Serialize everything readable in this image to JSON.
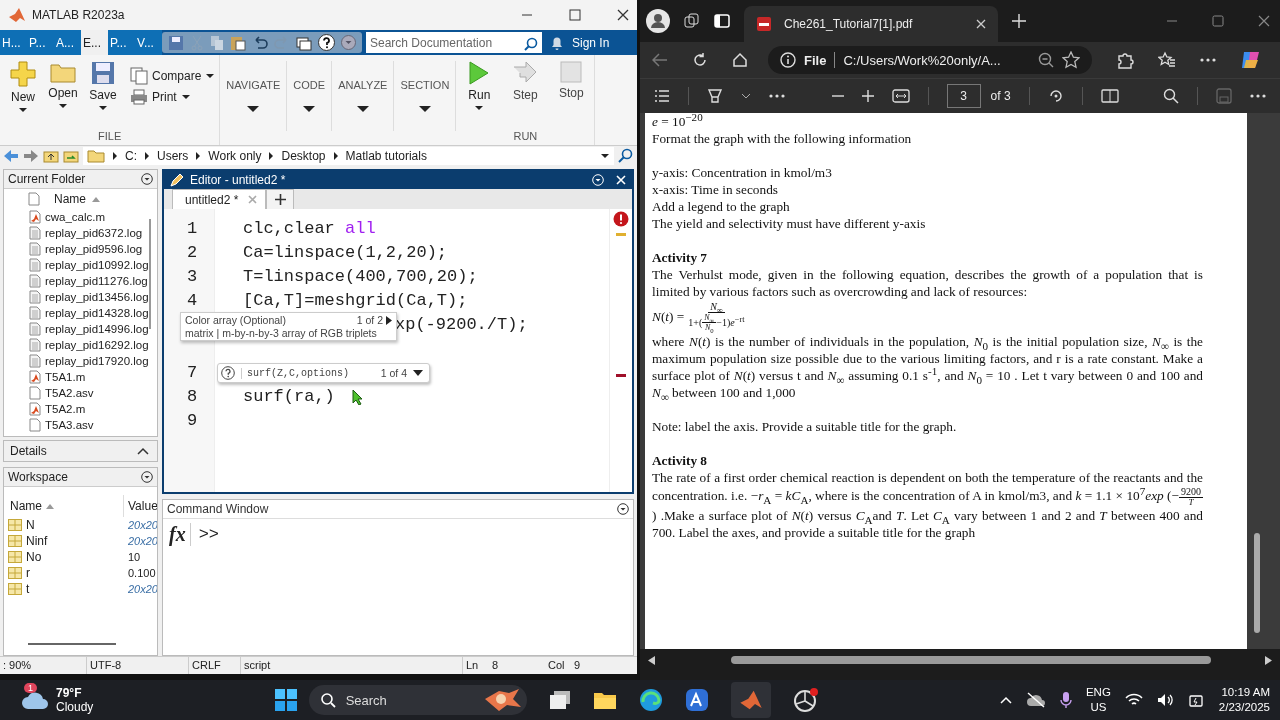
{
  "matlab": {
    "title": "MATLAB R2023a",
    "tabs": [
      {
        "label": "H...",
        "selected": false
      },
      {
        "label": "P...",
        "selected": false
      },
      {
        "label": "A...",
        "selected": false
      },
      {
        "label": "E...",
        "selected": true
      },
      {
        "label": "P...",
        "selected": false
      },
      {
        "label": "V...",
        "selected": false
      }
    ],
    "search": {
      "placeholder": "Search Documentation"
    },
    "sign_in": "Sign In",
    "file_buttons": [
      {
        "kind": "new",
        "label": "New"
      },
      {
        "kind": "open",
        "label": "Open"
      },
      {
        "kind": "save",
        "label": "Save"
      }
    ],
    "compare": "Compare",
    "print": "Print",
    "file_group": "FILE",
    "menus": [
      "NAVIGATE",
      "CODE",
      "ANALYZE",
      "SECTION"
    ],
    "run_buttons": [
      {
        "kind": "run",
        "label": "Run",
        "disabled": false
      },
      {
        "kind": "step",
        "label": "Step",
        "disabled": true
      },
      {
        "kind": "stop",
        "label": "Stop",
        "disabled": true
      }
    ],
    "run_group": "RUN",
    "path": [
      "C:",
      "Users",
      "Work only",
      "Desktop",
      "Matlab tutorials"
    ],
    "current_folder": {
      "title": "Current Folder",
      "column": "Name",
      "files": [
        {
          "name": "cwa_calc.m",
          "kind": "script"
        },
        {
          "name": "replay_pid6372.log",
          "kind": "text"
        },
        {
          "name": "replay_pid9596.log",
          "kind": "text"
        },
        {
          "name": "replay_pid10992.log",
          "kind": "text"
        },
        {
          "name": "replay_pid11276.log",
          "kind": "text"
        },
        {
          "name": "replay_pid13456.log",
          "kind": "text"
        },
        {
          "name": "replay_pid14328.log",
          "kind": "text"
        },
        {
          "name": "replay_pid14996.log",
          "kind": "text"
        },
        {
          "name": "replay_pid16292.log",
          "kind": "text"
        },
        {
          "name": "replay_pid17920.log",
          "kind": "text"
        },
        {
          "name": "T5A1.m",
          "kind": "script"
        },
        {
          "name": "T5A2.asv",
          "kind": "blank"
        },
        {
          "name": "T5A2.m",
          "kind": "script"
        },
        {
          "name": "T5A3.asv",
          "kind": "blank"
        }
      ]
    },
    "details": "Details",
    "workspace": {
      "title": "Workspace",
      "columns": [
        "Name",
        "Value"
      ],
      "vars": [
        {
          "name": "N",
          "value": "20x20",
          "kind": "matrix"
        },
        {
          "name": "Ninf",
          "value": "20x20",
          "kind": "matrix"
        },
        {
          "name": "No",
          "value": "10",
          "kind": "scalar"
        },
        {
          "name": "r",
          "value": "0.100",
          "kind": "scalar"
        },
        {
          "name": "t",
          "value": "20x20",
          "kind": "matrix"
        }
      ]
    },
    "editor": {
      "title": "Editor - untitled2 *",
      "tab": "untitled2 *",
      "lines": [
        {
          "num": "1",
          "kind": "code",
          "parts": [
            {
              "text": "clc,clear ",
              "kind": "plain"
            },
            {
              "text": "all",
              "kind": "keyword"
            }
          ]
        },
        {
          "num": "2",
          "kind": "code",
          "parts": [
            {
              "text": "Ca=linspace(1,2,20);",
              "kind": "plain"
            }
          ]
        },
        {
          "num": "3",
          "kind": "code",
          "parts": [
            {
              "text": "T=linspace(400,700,20);",
              "kind": "plain"
            }
          ]
        },
        {
          "num": "4",
          "kind": "code",
          "parts": [
            {
              "text": "[Ca,T]=meshgrid(Ca,T);",
              "kind": "plain"
            }
          ]
        },
        {
          "kind": "covered",
          "parts": [
            {
              "text": "xp(-9200./T);",
              "kind": "plain"
            }
          ]
        },
        {
          "kind": "hidden"
        },
        {
          "num": "7",
          "kind": "hidden"
        },
        {
          "num": "8",
          "kind": "code",
          "parts": [
            {
              "text": "surf(ra,)",
              "kind": "plain"
            }
          ]
        },
        {
          "num": "9",
          "kind": "code"
        }
      ],
      "hint": {
        "title": "Color array (Optional)",
        "count": "1 of 2",
        "detail": "matrix | m-by-n-by-3 array of RGB triplets"
      },
      "signature": {
        "text": "surf(Z,C,options)",
        "count": "1 of 4"
      }
    },
    "command_window": {
      "title": "Command Window",
      "fx": "fx",
      "prompt": ">>"
    },
    "status_bar": {
      "zoom": ": 90%",
      "encoding": "UTF-8",
      "line_ending": "CRLF",
      "type": "script",
      "ln_label": "Ln",
      "ln": "8",
      "col_label": "Col",
      "col": "9"
    }
  },
  "browser": {
    "tab": "Che261_Tutorial7[1].pdf",
    "file_label": "File",
    "url": "C:/Users/Work%20only/A...",
    "page": "3",
    "page_total": "of 3",
    "pdf": [
      {
        "kind": "line",
        "text": "*e* = 10$^{−20}$"
      },
      {
        "kind": "line",
        "text": "Format the graph with the following information"
      },
      {
        "kind": "gap"
      },
      {
        "kind": "line",
        "text": "y-axis: Concentration in kmol/m3"
      },
      {
        "kind": "line",
        "text": "x-axis: Time in seconds"
      },
      {
        "kind": "line",
        "text": "Add a legend to the graph"
      },
      {
        "kind": "line",
        "text": "The yield and selectivity must have different y-axis"
      },
      {
        "kind": "gap"
      },
      {
        "kind": "heading",
        "text": "Activity 7"
      },
      {
        "kind": "para",
        "text": "The Verhulst mode, given in the following equation, describes the growth of a population that is limited by various factors such as overcrowding and lack of resources:"
      },
      {
        "kind": "formula",
        "lhs": "*N*(*t*) =",
        "num": "*N*$_{∞}$",
        "den_before": "1+(",
        "inner_num": "*N*$_{∞}$",
        "inner_den": "*N*$_{0}$",
        "den_after": "−1)*e*$^{−rt}$"
      },
      {
        "kind": "para",
        "text": "where *N*(*t*) is the number of individuals in the population, *N*$_{0}$ is the initial population size, *N*$_{∞}$ is the maximum population size possible due to the various limiting factors, and r is a rate constant. Make a surface plot of *N*(*t*) versus t and *N*$_{∞}$ assuming 0.1 s$^{-1}$, and *N*$_{0}$ = 10 . Let t vary between 0 and 100 and *N*$_{∞}$ between 100 and 1,000"
      },
      {
        "kind": "gap"
      },
      {
        "kind": "line",
        "text": "Note: label the axis. Provide a suitable title for the graph."
      },
      {
        "kind": "gap"
      },
      {
        "kind": "heading",
        "text": "Activity 8"
      },
      {
        "kind": "para_frac",
        "before": "The rate of a first order chemical reaction is dependent on both the temperature of the reactants and the concentration. i.e. −*r*$_{A}$ = *kC*$_{A}$, where is the concentration of A in kmol/m3, and *k* = 1.1 × 10$^{7}$*exp* (−",
        "num": "9200",
        "den": "*T*",
        "after": ") .Make a surface plot of *N*(*t*) versus *C*$_{A}$and *T*. Let *C*$_{A}$ vary between 1 and 2 and *T* between 400 and 700. Label the axes, and provide a suitable title for the graph"
      }
    ]
  },
  "taskbar": {
    "temperature": "79°F",
    "weather": "Cloudy",
    "badge": "1",
    "search": "Search",
    "language": "ENG",
    "region": "US",
    "time": "10:19 AM",
    "date": "2/23/2025"
  }
}
